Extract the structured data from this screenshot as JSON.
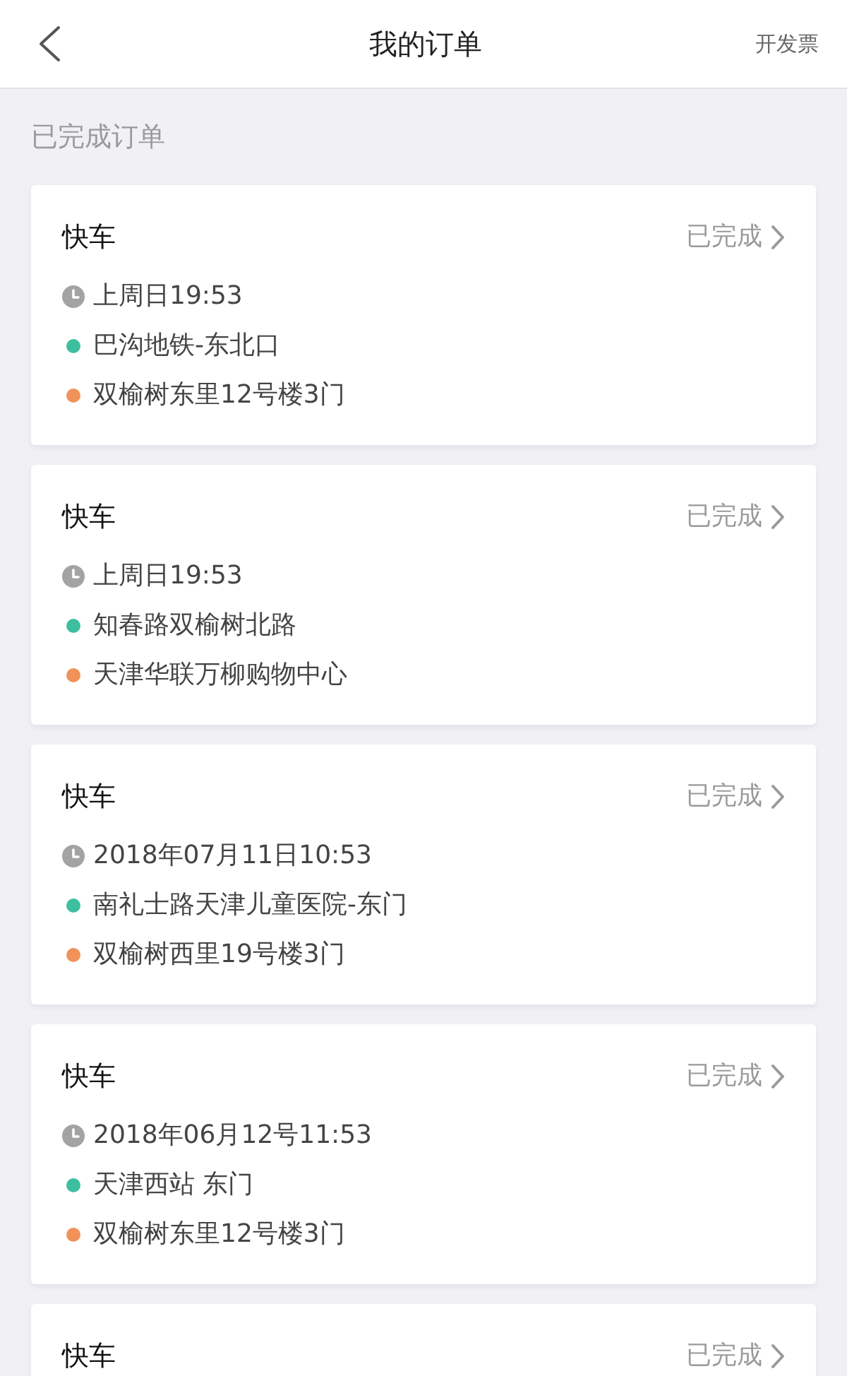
{
  "nav": {
    "title": "我的订单",
    "action": "开发票"
  },
  "section_title": "已完成订单",
  "orders": [
    {
      "type": "快车",
      "status": "已完成",
      "time": "上周日19:53",
      "stops": [
        {
          "name": "巴沟地铁-东北口",
          "color": "#3dbf9f"
        },
        {
          "name": "双榆树东里12号楼3门",
          "color": "#f0925a"
        }
      ]
    },
    {
      "type": "快车",
      "status": "已完成",
      "time": "上周日19:53",
      "stops": [
        {
          "name": "知春路双榆树北路",
          "color": "#3dbf9f"
        },
        {
          "name": "天津华联万柳购物中心",
          "color": "#f0925a"
        }
      ]
    },
    {
      "type": "快车",
      "status": "已完成",
      "time": "2018年07月11日10:53",
      "stops": [
        {
          "name": "南礼士路天津儿童医院-东门",
          "color": "#3dbf9f"
        },
        {
          "name": "双榆树西里19号楼3门",
          "color": "#f0925a"
        }
      ]
    },
    {
      "type": "快车",
      "status": "已完成",
      "time": "2018年06月12号11:53",
      "stops": [
        {
          "name": "天津西站 东门",
          "color": "#3dbf9f"
        },
        {
          "name": "双榆树东里12号楼3门",
          "color": "#f0925a"
        }
      ]
    },
    {
      "type": "快车",
      "status": "已完成"
    }
  ]
}
